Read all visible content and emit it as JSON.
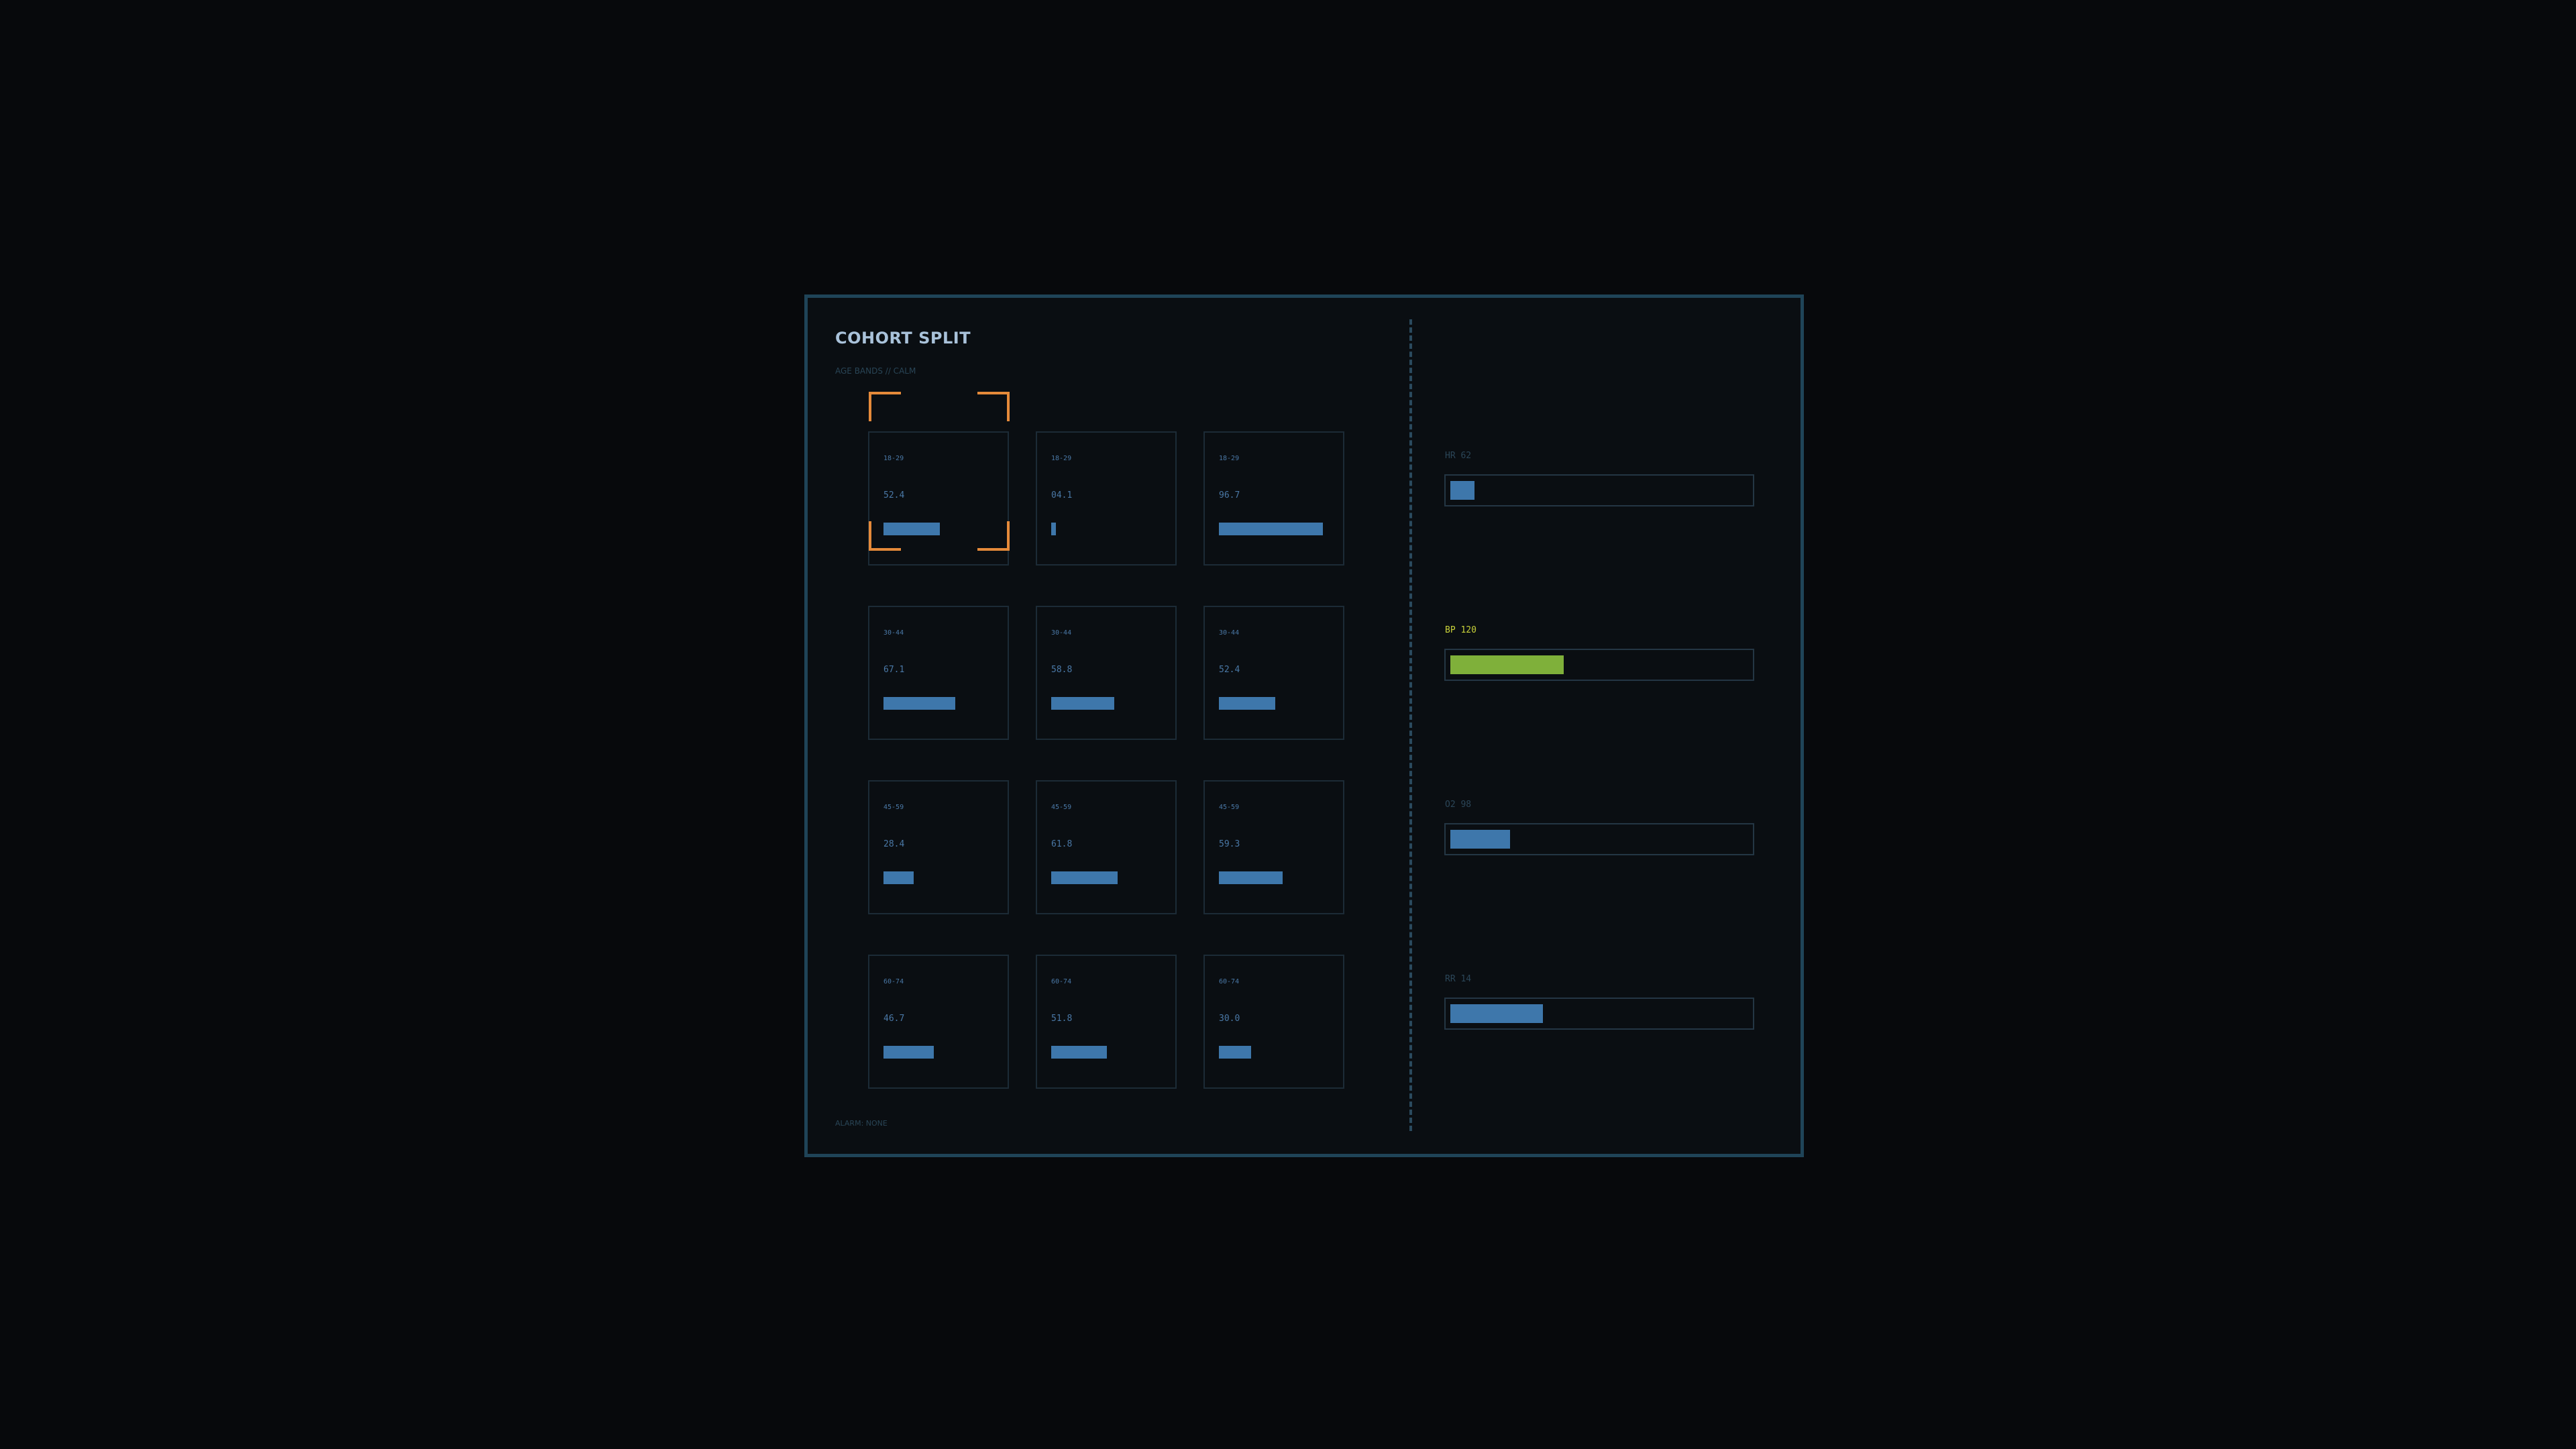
{
  "panel": {
    "title": "COHORT SPLIT",
    "subtitle": "AGE BANDS // CALM",
    "footer": "ALARM: NONE"
  },
  "colors": {
    "background": "#07090c",
    "panel_border": "#1f4458",
    "bar": "#3e77ab",
    "highlight_bar": "#7fb03a",
    "focus_bracket": "#e58a3a"
  },
  "cohorts": [
    {
      "band": "18-29",
      "value": "52.4",
      "level": 0.524
    },
    {
      "band": "18-29",
      "value": "04.1",
      "level": 0.041
    },
    {
      "band": "18-29",
      "value": "96.7",
      "level": 0.967
    },
    {
      "band": "30-44",
      "value": "67.1",
      "level": 0.671
    },
    {
      "band": "30-44",
      "value": "58.8",
      "level": 0.588
    },
    {
      "band": "30-44",
      "value": "52.4",
      "level": 0.524
    },
    {
      "band": "45-59",
      "value": "28.4",
      "level": 0.284
    },
    {
      "band": "45-59",
      "value": "61.8",
      "level": 0.618
    },
    {
      "band": "45-59",
      "value": "59.3",
      "level": 0.593
    },
    {
      "band": "60-74",
      "value": "46.7",
      "level": 0.467
    },
    {
      "band": "60-74",
      "value": "51.8",
      "level": 0.518
    },
    {
      "band": "60-74",
      "value": "30.0",
      "level": 0.3
    }
  ],
  "focused_cell": 0,
  "vitals": [
    {
      "label": "HR 62",
      "level": 0.08,
      "highlight": false
    },
    {
      "label": "BP 120",
      "level": 0.38,
      "highlight": true
    },
    {
      "label": "O2 98",
      "level": 0.2,
      "highlight": false
    },
    {
      "label": "RR 14",
      "level": 0.31,
      "highlight": false
    }
  ]
}
